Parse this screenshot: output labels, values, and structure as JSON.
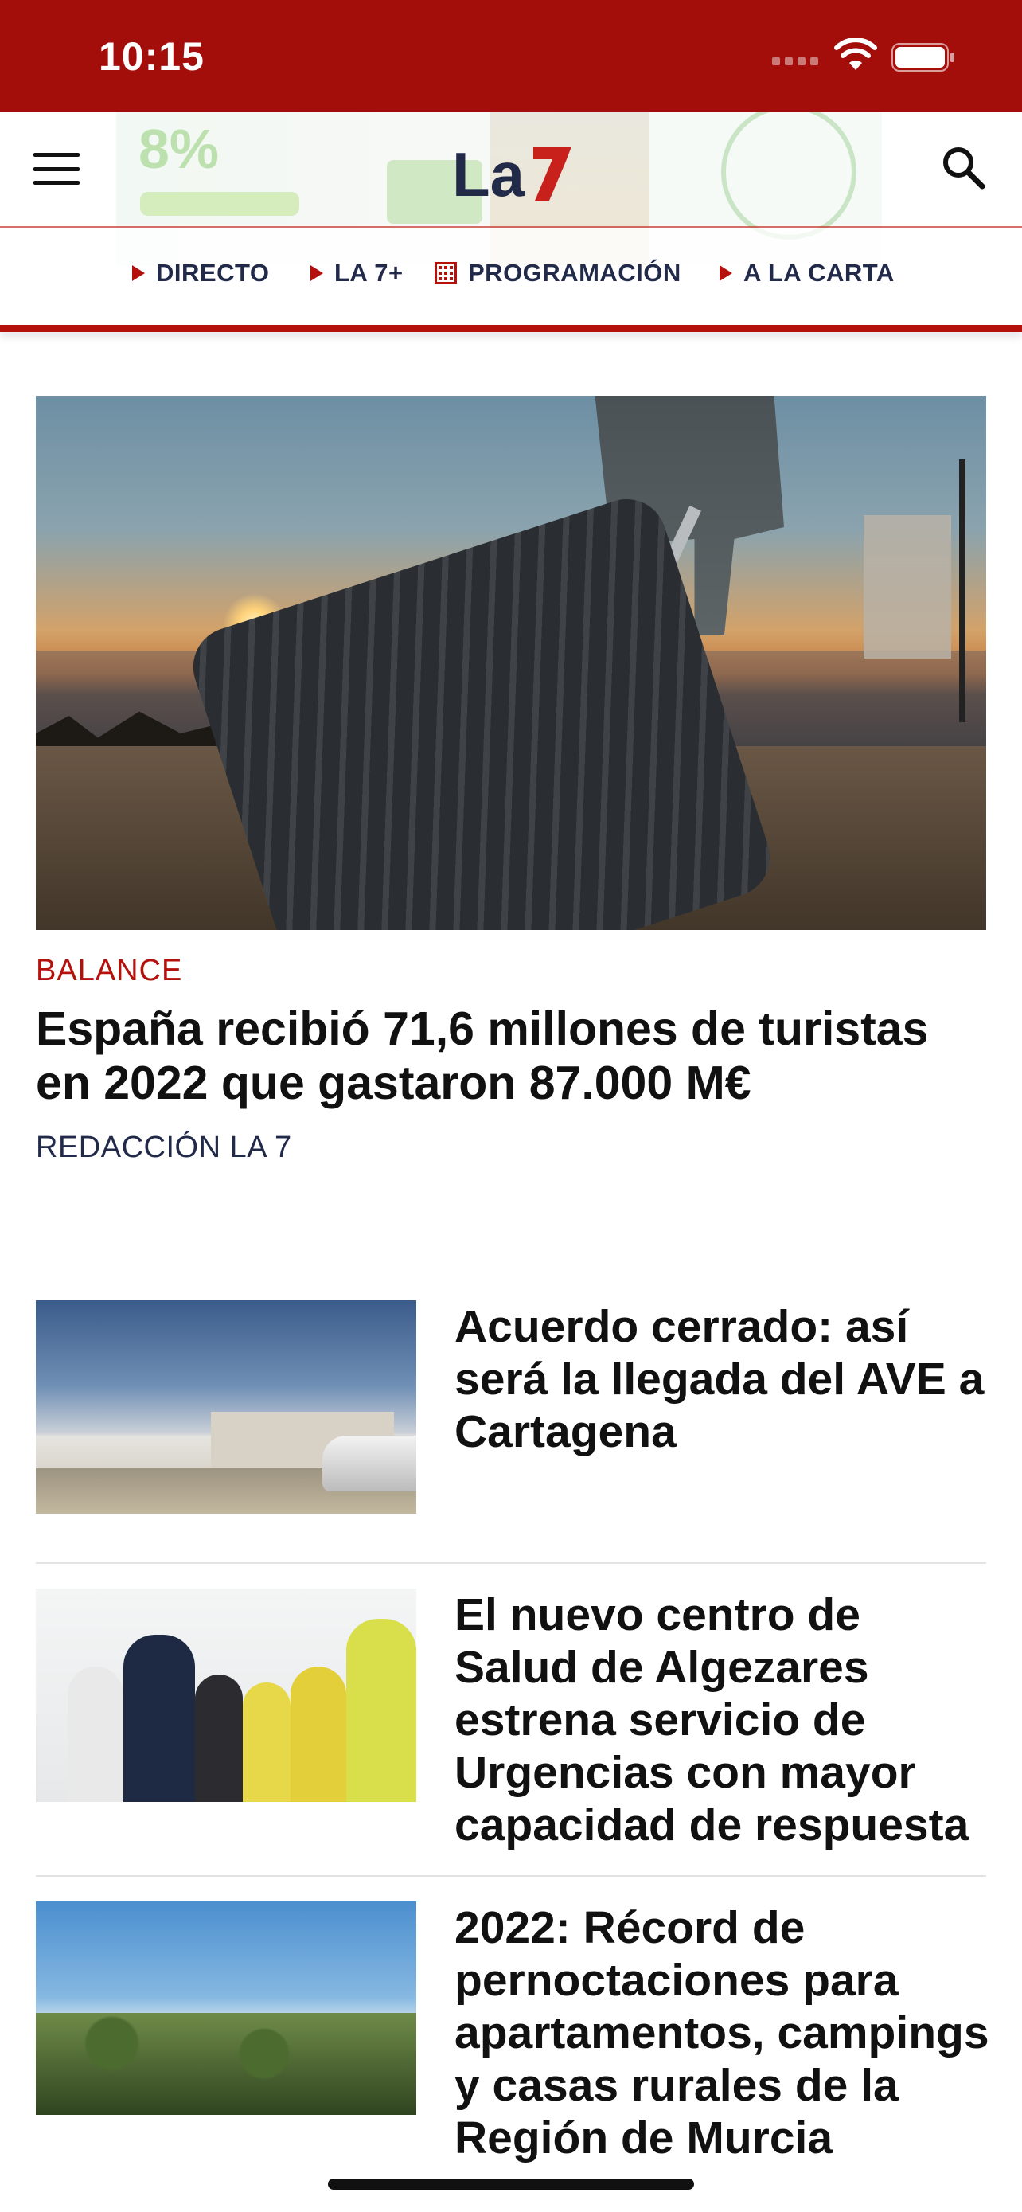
{
  "status_bar": {
    "time": "10:15"
  },
  "header": {
    "logo_text": "La 7",
    "colors": {
      "brand_red": "#b4110c",
      "navy": "#222a4a"
    },
    "icons": {
      "menu": "hamburger-menu-icon",
      "search": "search-icon"
    }
  },
  "nav": {
    "items": [
      {
        "label": "DIRECTO",
        "icon": "play-triangle-icon"
      },
      {
        "label": "LA 7+",
        "icon": "play-triangle-icon"
      },
      {
        "label": "PROGRAMACIÓN",
        "icon": "calendar-grid-icon"
      },
      {
        "label": "A LA CARTA",
        "icon": "play-triangle-icon"
      }
    ]
  },
  "hero": {
    "kicker": "BALANCE",
    "title": "España recibió 71,6 millones de turistas en 2022 que gastaron 87.000 M€",
    "author": "REDACCIÓN LA 7"
  },
  "articles": [
    {
      "title": "Acuerdo cerrado: así será la llegada del AVE a Cartagena"
    },
    {
      "title": "El nuevo centro de Salud de Algezares estrena servicio de Urgencias con mayor capacidad de respuesta"
    },
    {
      "title": "2022: Récord de pernoctaciones para apartamentos, campings y casas rurales de la Región de Murcia"
    }
  ]
}
